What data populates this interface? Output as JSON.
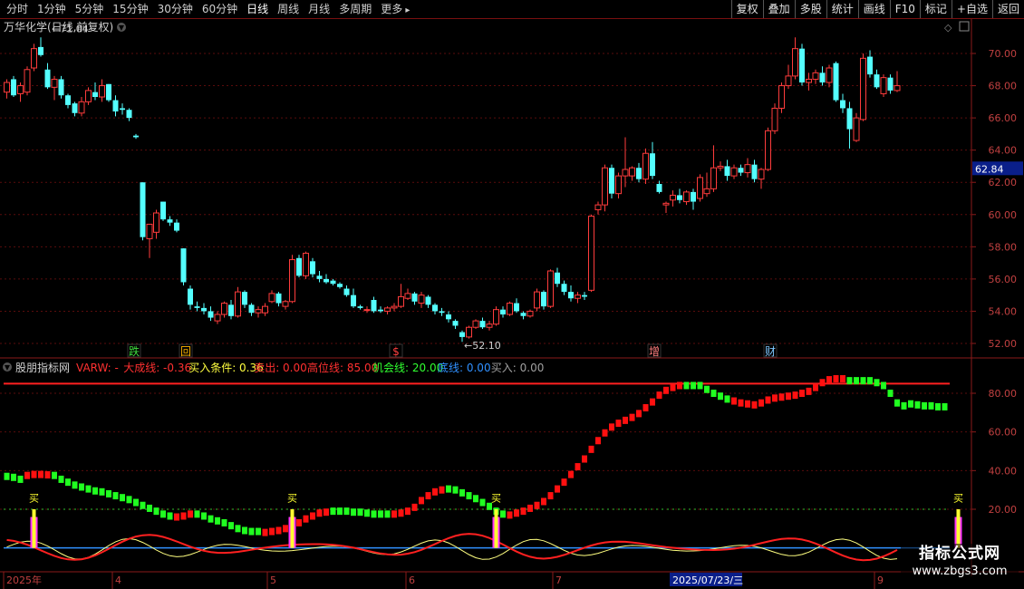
{
  "toolbar": {
    "periods": [
      "分时",
      "1分钟",
      "5分钟",
      "15分钟",
      "30分钟",
      "60分钟",
      "日线",
      "周线",
      "月线",
      "多周期",
      "更多"
    ],
    "more_arrow": "▸",
    "active_period": "日线",
    "tools": [
      "复权",
      "叠加",
      "多股",
      "统计",
      "画线",
      "F10",
      "标记",
      "+自选",
      "返回"
    ]
  },
  "price_panel": {
    "title": "万华化学(日线,前复权)",
    "high_label": "71.04",
    "low_label": "52.10",
    "current_price": "62.84",
    "y_axis_ticks": [
      "70.00",
      "68.00",
      "66.00",
      "64.00",
      "62.00",
      "60.00",
      "58.00",
      "56.00",
      "54.00",
      "52.00"
    ],
    "markers": [
      {
        "text": "跌",
        "color": "#3fdc3f"
      },
      {
        "text": "回",
        "color": "#ffb400"
      },
      {
        "text": "$",
        "color": "#ff4040"
      },
      {
        "text": "增",
        "color": "#ff8080"
      },
      {
        "text": "财",
        "color": "#7ec8ff"
      }
    ]
  },
  "indicator_panel": {
    "name": "股朋指标网",
    "legend": [
      {
        "text": "VARW: -",
        "color": "#ff3030"
      },
      {
        "text": "大成线: -0.36",
        "color": "#ff3030"
      },
      {
        "text": "买入条件: 0.36",
        "color": "#ffff40"
      },
      {
        "text": "卖出: 0.00",
        "color": "#ff3030"
      },
      {
        "text": "高位线: 85.00",
        "color": "#ff3030"
      },
      {
        "text": "机会线: 20.00",
        "color": "#30ff30"
      },
      {
        "text": "底线: 0.00",
        "color": "#3090ff"
      },
      {
        "text": "买入: 0.00",
        "color": "#a0a0a0"
      }
    ],
    "y_axis_ticks": [
      "80.00",
      "60.00",
      "40.00",
      "20.00"
    ],
    "buy_label": "买"
  },
  "date_axis": {
    "labels": [
      "2025年",
      "4",
      "5",
      "6",
      "7",
      "9"
    ],
    "cursor_date": "2025/07/23/三"
  },
  "watermark": {
    "title": "指标公式网",
    "url": "www.zbgs3.com"
  },
  "chart_data": {
    "type": "candlestick",
    "title": "万华化学(日线,前复权)",
    "ylim": [
      51.0,
      71.5
    ],
    "candles": [
      {
        "o": 67.6,
        "h": 68.4,
        "l": 67.2,
        "c": 68.2
      },
      {
        "o": 68.4,
        "h": 68.6,
        "l": 67.3,
        "c": 67.4
      },
      {
        "o": 67.5,
        "h": 68.2,
        "l": 67.0,
        "c": 68.0
      },
      {
        "o": 67.6,
        "h": 69.2,
        "l": 67.4,
        "c": 69.0
      },
      {
        "o": 69.1,
        "h": 70.6,
        "l": 68.9,
        "c": 70.3
      },
      {
        "o": 70.4,
        "h": 71.0,
        "l": 69.8,
        "c": 69.9
      },
      {
        "o": 69.0,
        "h": 69.4,
        "l": 67.8,
        "c": 67.9
      },
      {
        "o": 67.9,
        "h": 68.6,
        "l": 67.1,
        "c": 68.4
      },
      {
        "o": 68.4,
        "h": 68.6,
        "l": 67.2,
        "c": 67.4
      },
      {
        "o": 67.4,
        "h": 67.5,
        "l": 66.6,
        "c": 66.8
      },
      {
        "o": 66.9,
        "h": 67.0,
        "l": 66.1,
        "c": 66.3
      },
      {
        "o": 66.3,
        "h": 67.3,
        "l": 66.1,
        "c": 67.0
      },
      {
        "o": 67.0,
        "h": 67.9,
        "l": 66.8,
        "c": 67.7
      },
      {
        "o": 67.6,
        "h": 68.2,
        "l": 67.1,
        "c": 67.3
      },
      {
        "o": 67.3,
        "h": 68.4,
        "l": 67.0,
        "c": 68.0
      },
      {
        "o": 68.1,
        "h": 68.1,
        "l": 67.0,
        "c": 67.1
      },
      {
        "o": 67.1,
        "h": 67.4,
        "l": 66.1,
        "c": 66.4
      },
      {
        "o": 66.6,
        "h": 66.9,
        "l": 66.2,
        "c": 66.5
      },
      {
        "o": 66.5,
        "h": 66.6,
        "l": 65.8,
        "c": 66.0
      },
      {
        "o": 64.9,
        "h": 65.0,
        "l": 64.7,
        "c": 64.8
      },
      {
        "o": 62.0,
        "h": 62.0,
        "l": 58.4,
        "c": 58.6
      },
      {
        "o": 58.5,
        "h": 59.4,
        "l": 57.3,
        "c": 59.4
      },
      {
        "o": 58.9,
        "h": 60.3,
        "l": 58.5,
        "c": 60.1
      },
      {
        "o": 60.8,
        "h": 60.8,
        "l": 59.6,
        "c": 59.7
      },
      {
        "o": 59.7,
        "h": 59.9,
        "l": 59.3,
        "c": 59.5
      },
      {
        "o": 59.5,
        "h": 59.7,
        "l": 58.9,
        "c": 59.0
      },
      {
        "o": 57.9,
        "h": 57.9,
        "l": 55.6,
        "c": 55.8
      },
      {
        "o": 55.4,
        "h": 55.6,
        "l": 54.1,
        "c": 54.4
      },
      {
        "o": 54.3,
        "h": 54.6,
        "l": 54.0,
        "c": 54.2
      },
      {
        "o": 54.2,
        "h": 54.5,
        "l": 53.8,
        "c": 54.0
      },
      {
        "o": 54.0,
        "h": 54.3,
        "l": 53.4,
        "c": 53.6
      },
      {
        "o": 53.4,
        "h": 54.0,
        "l": 53.2,
        "c": 53.8
      },
      {
        "o": 53.8,
        "h": 54.6,
        "l": 53.6,
        "c": 54.5
      },
      {
        "o": 54.4,
        "h": 54.7,
        "l": 53.5,
        "c": 53.7
      },
      {
        "o": 53.7,
        "h": 55.5,
        "l": 53.6,
        "c": 55.2
      },
      {
        "o": 55.2,
        "h": 55.3,
        "l": 54.2,
        "c": 54.4
      },
      {
        "o": 54.4,
        "h": 54.5,
        "l": 53.7,
        "c": 53.9
      },
      {
        "o": 53.9,
        "h": 54.3,
        "l": 53.6,
        "c": 54.1
      },
      {
        "o": 53.9,
        "h": 54.5,
        "l": 53.7,
        "c": 54.3
      },
      {
        "o": 54.6,
        "h": 55.3,
        "l": 54.5,
        "c": 55.1
      },
      {
        "o": 55.1,
        "h": 55.2,
        "l": 54.3,
        "c": 54.5
      },
      {
        "o": 54.3,
        "h": 54.7,
        "l": 54.1,
        "c": 54.6
      },
      {
        "o": 54.6,
        "h": 57.5,
        "l": 54.5,
        "c": 57.2
      },
      {
        "o": 57.3,
        "h": 57.5,
        "l": 56.1,
        "c": 56.2
      },
      {
        "o": 56.2,
        "h": 57.7,
        "l": 56.0,
        "c": 57.6
      },
      {
        "o": 57.1,
        "h": 57.3,
        "l": 56.1,
        "c": 56.3
      },
      {
        "o": 56.2,
        "h": 56.5,
        "l": 55.8,
        "c": 56.0
      },
      {
        "o": 56.0,
        "h": 56.3,
        "l": 55.7,
        "c": 55.8
      },
      {
        "o": 55.9,
        "h": 56.0,
        "l": 55.6,
        "c": 55.7
      },
      {
        "o": 55.7,
        "h": 55.8,
        "l": 55.4,
        "c": 55.5
      },
      {
        "o": 55.4,
        "h": 55.6,
        "l": 54.9,
        "c": 55.0
      },
      {
        "o": 55.0,
        "h": 55.4,
        "l": 54.2,
        "c": 54.3
      },
      {
        "o": 54.3,
        "h": 54.4,
        "l": 54.1,
        "c": 54.2
      },
      {
        "o": 54.1,
        "h": 54.3,
        "l": 53.9,
        "c": 54.1
      },
      {
        "o": 54.7,
        "h": 54.9,
        "l": 53.9,
        "c": 54.0
      },
      {
        "o": 54.1,
        "h": 54.3,
        "l": 53.9,
        "c": 54.0
      },
      {
        "o": 54.0,
        "h": 54.3,
        "l": 53.8,
        "c": 54.2
      },
      {
        "o": 54.2,
        "h": 54.5,
        "l": 54.0,
        "c": 54.3
      },
      {
        "o": 54.3,
        "h": 55.7,
        "l": 54.2,
        "c": 54.9
      },
      {
        "o": 54.8,
        "h": 55.4,
        "l": 54.7,
        "c": 55.1
      },
      {
        "o": 55.1,
        "h": 55.2,
        "l": 54.4,
        "c": 54.6
      },
      {
        "o": 54.5,
        "h": 55.2,
        "l": 54.2,
        "c": 55.0
      },
      {
        "o": 54.9,
        "h": 55.0,
        "l": 54.2,
        "c": 54.4
      },
      {
        "o": 54.4,
        "h": 54.5,
        "l": 53.8,
        "c": 54.0
      },
      {
        "o": 54.0,
        "h": 54.2,
        "l": 53.7,
        "c": 53.9
      },
      {
        "o": 53.8,
        "h": 54.0,
        "l": 53.3,
        "c": 53.5
      },
      {
        "o": 53.4,
        "h": 53.5,
        "l": 52.9,
        "c": 53.1
      },
      {
        "o": 52.7,
        "h": 52.8,
        "l": 52.1,
        "c": 52.4
      },
      {
        "o": 52.4,
        "h": 53.1,
        "l": 52.3,
        "c": 53.0
      },
      {
        "o": 53.0,
        "h": 53.5,
        "l": 52.9,
        "c": 53.4
      },
      {
        "o": 53.4,
        "h": 53.6,
        "l": 52.9,
        "c": 53.0
      },
      {
        "o": 53.0,
        "h": 53.4,
        "l": 52.8,
        "c": 53.2
      },
      {
        "o": 53.2,
        "h": 54.3,
        "l": 53.1,
        "c": 54.1
      },
      {
        "o": 54.1,
        "h": 54.3,
        "l": 53.6,
        "c": 53.8
      },
      {
        "o": 53.8,
        "h": 54.6,
        "l": 53.7,
        "c": 54.5
      },
      {
        "o": 54.5,
        "h": 54.8,
        "l": 53.9,
        "c": 54.0
      },
      {
        "o": 53.9,
        "h": 54.0,
        "l": 53.5,
        "c": 53.7
      },
      {
        "o": 53.7,
        "h": 54.1,
        "l": 53.6,
        "c": 54.0
      },
      {
        "o": 54.2,
        "h": 55.4,
        "l": 54.0,
        "c": 55.2
      },
      {
        "o": 55.2,
        "h": 55.3,
        "l": 54.1,
        "c": 54.3
      },
      {
        "o": 54.3,
        "h": 56.6,
        "l": 54.2,
        "c": 56.5
      },
      {
        "o": 56.4,
        "h": 56.7,
        "l": 55.5,
        "c": 55.7
      },
      {
        "o": 55.7,
        "h": 55.9,
        "l": 55.0,
        "c": 55.2
      },
      {
        "o": 55.2,
        "h": 55.6,
        "l": 54.6,
        "c": 54.8
      },
      {
        "o": 54.8,
        "h": 55.2,
        "l": 54.5,
        "c": 55.0
      },
      {
        "o": 55.0,
        "h": 55.2,
        "l": 54.7,
        "c": 54.9
      },
      {
        "o": 55.3,
        "h": 60.0,
        "l": 55.2,
        "c": 59.9
      },
      {
        "o": 60.3,
        "h": 60.8,
        "l": 60.0,
        "c": 60.6
      },
      {
        "o": 60.6,
        "h": 63.1,
        "l": 60.2,
        "c": 62.9
      },
      {
        "o": 62.9,
        "h": 63.1,
        "l": 61.0,
        "c": 61.3
      },
      {
        "o": 61.3,
        "h": 62.6,
        "l": 61.0,
        "c": 62.4
      },
      {
        "o": 62.4,
        "h": 64.8,
        "l": 61.7,
        "c": 62.8
      },
      {
        "o": 62.4,
        "h": 63.0,
        "l": 62.1,
        "c": 62.9
      },
      {
        "o": 62.9,
        "h": 63.2,
        "l": 62.0,
        "c": 62.2
      },
      {
        "o": 62.2,
        "h": 64.1,
        "l": 61.9,
        "c": 63.8
      },
      {
        "o": 63.8,
        "h": 64.5,
        "l": 62.2,
        "c": 62.4
      },
      {
        "o": 61.9,
        "h": 62.1,
        "l": 61.3,
        "c": 61.4
      },
      {
        "o": 60.6,
        "h": 60.8,
        "l": 60.1,
        "c": 60.7
      },
      {
        "o": 60.9,
        "h": 61.5,
        "l": 60.5,
        "c": 61.2
      },
      {
        "o": 61.2,
        "h": 61.6,
        "l": 60.7,
        "c": 60.9
      },
      {
        "o": 60.8,
        "h": 61.5,
        "l": 60.6,
        "c": 61.4
      },
      {
        "o": 61.4,
        "h": 61.6,
        "l": 60.3,
        "c": 60.8
      },
      {
        "o": 61.0,
        "h": 62.5,
        "l": 60.8,
        "c": 62.3
      },
      {
        "o": 61.3,
        "h": 62.6,
        "l": 61.1,
        "c": 61.6
      },
      {
        "o": 61.6,
        "h": 64.3,
        "l": 61.4,
        "c": 62.9
      },
      {
        "o": 62.9,
        "h": 63.3,
        "l": 62.7,
        "c": 63.0
      },
      {
        "o": 63.0,
        "h": 63.4,
        "l": 62.1,
        "c": 62.4
      },
      {
        "o": 62.4,
        "h": 63.1,
        "l": 62.2,
        "c": 62.9
      },
      {
        "o": 62.9,
        "h": 63.1,
        "l": 62.4,
        "c": 62.6
      },
      {
        "o": 62.6,
        "h": 63.5,
        "l": 62.3,
        "c": 63.1
      },
      {
        "o": 63.1,
        "h": 63.4,
        "l": 62.0,
        "c": 62.2
      },
      {
        "o": 62.2,
        "h": 62.9,
        "l": 61.6,
        "c": 62.8
      },
      {
        "o": 62.8,
        "h": 65.4,
        "l": 62.7,
        "c": 65.2
      },
      {
        "o": 65.2,
        "h": 66.9,
        "l": 65.0,
        "c": 66.6
      },
      {
        "o": 66.6,
        "h": 68.2,
        "l": 66.3,
        "c": 68.0
      },
      {
        "o": 68.0,
        "h": 69.3,
        "l": 67.8,
        "c": 68.6
      },
      {
        "o": 68.6,
        "h": 71.0,
        "l": 68.4,
        "c": 70.3
      },
      {
        "o": 70.3,
        "h": 70.6,
        "l": 68.0,
        "c": 68.2
      },
      {
        "o": 68.2,
        "h": 68.8,
        "l": 67.7,
        "c": 68.4
      },
      {
        "o": 68.4,
        "h": 69.0,
        "l": 68.1,
        "c": 68.8
      },
      {
        "o": 68.8,
        "h": 69.2,
        "l": 68.0,
        "c": 68.2
      },
      {
        "o": 68.2,
        "h": 69.3,
        "l": 67.9,
        "c": 69.1
      },
      {
        "o": 69.4,
        "h": 69.5,
        "l": 67.0,
        "c": 67.1
      },
      {
        "o": 67.1,
        "h": 67.5,
        "l": 66.3,
        "c": 66.6
      },
      {
        "o": 66.6,
        "h": 67.0,
        "l": 64.1,
        "c": 65.3
      },
      {
        "o": 64.6,
        "h": 66.3,
        "l": 64.5,
        "c": 66.0
      },
      {
        "o": 65.9,
        "h": 70.0,
        "l": 65.8,
        "c": 69.7
      },
      {
        "o": 69.8,
        "h": 70.2,
        "l": 68.5,
        "c": 68.7
      },
      {
        "o": 68.7,
        "h": 69.0,
        "l": 67.8,
        "c": 67.9
      },
      {
        "o": 67.5,
        "h": 68.7,
        "l": 67.3,
        "c": 68.5
      },
      {
        "o": 68.5,
        "h": 68.7,
        "l": 67.5,
        "c": 67.7
      },
      {
        "o": 67.7,
        "h": 68.9,
        "l": 67.6,
        "c": 68.0
      }
    ],
    "indicator": {
      "ylim": [
        -5,
        95
      ],
      "high_line": 85,
      "chance_line": 20,
      "bottom_line": 0,
      "trend_values": [
        37.0,
        36.5,
        35.5,
        37.5,
        38.0,
        38.0,
        37.8,
        37.5,
        35.5,
        34.0,
        32.5,
        31.5,
        30.5,
        29.5,
        29.0,
        28.0,
        27.0,
        26.0,
        25.0,
        23.5,
        22.0,
        20.5,
        19.0,
        17.5,
        16.5,
        16.0,
        16.5,
        17.5,
        17.5,
        16.5,
        15.0,
        14.0,
        13.0,
        11.5,
        10.0,
        9.0,
        8.5,
        8.5,
        8.0,
        8.5,
        9.0,
        10.0,
        11.5,
        13.0,
        15.0,
        16.5,
        18.0,
        18.5,
        19.0,
        19.0,
        19.0,
        18.5,
        18.5,
        18.0,
        17.5,
        17.5,
        17.5,
        17.5,
        18.0,
        19.0,
        21.0,
        24.5,
        27.0,
        29.0,
        30.0,
        30.5,
        30.0,
        28.5,
        27.0,
        25.5,
        23.5,
        21.5,
        19.0,
        17.5,
        17.0,
        18.0,
        19.0,
        20.5,
        22.0,
        24.0,
        27.0,
        30.5,
        34.0,
        38.0,
        42.0,
        46.0,
        51.0,
        55.5,
        59.5,
        62.5,
        64.5,
        66.0,
        67.5,
        69.5,
        72.5,
        75.5,
        79.0,
        81.5,
        83.0,
        84.0,
        84.0,
        84.0,
        84.0,
        82.0,
        80.0,
        78.5,
        77.0,
        76.0,
        75.0,
        74.5,
        74.0,
        75.0,
        76.5,
        77.5,
        78.0,
        78.5,
        79.0,
        80.0,
        81.0,
        83.0,
        85.5,
        87.0,
        87.5,
        87.5,
        86.5,
        86.5,
        86.5,
        86.5,
        85.5,
        84.0,
        80.0,
        75.0,
        73.5,
        74.5,
        74.0,
        73.5,
        73.5,
        73.0,
        73.0
      ],
      "trend_colors": "GGGRRRRGGGGGGGGGGGGGGGGGGRRRGGGGGGGGGGRRRRRRRRRRGGGGGGGGGRRRRRRRRGGGGGGGGGRRRRRRRRRRRRRRRRRRRRRRRRRRGGGGGGGRRRRRRRRRRRRRRRRRGGGGGGGGG",
      "buy_signal_indices": [
        4,
        42,
        72,
        140
      ]
    }
  }
}
